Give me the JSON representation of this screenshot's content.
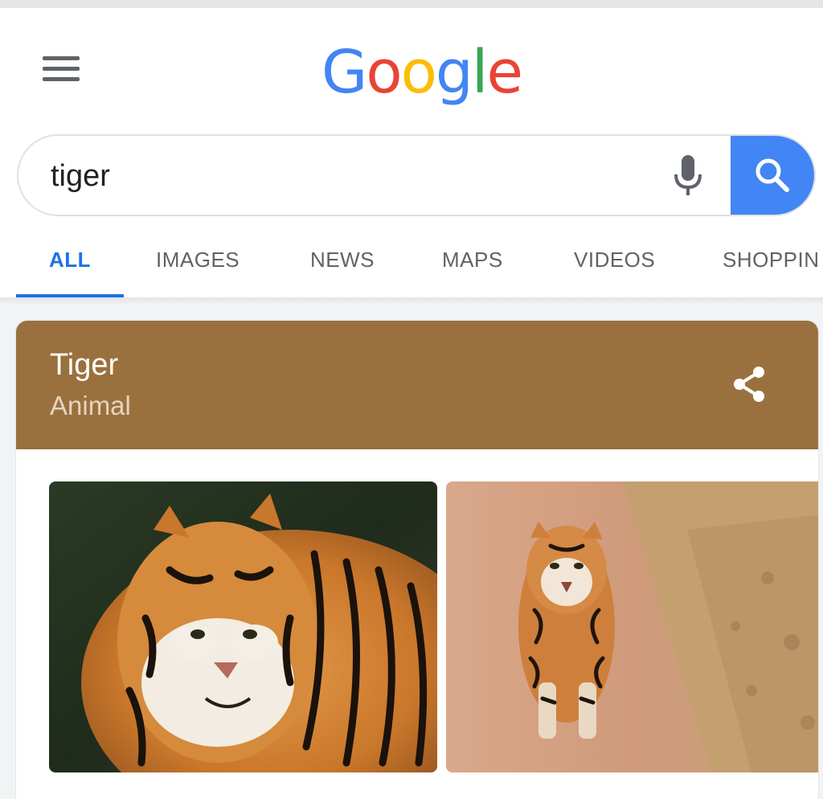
{
  "header": {
    "menu_icon": "hamburger-menu-icon",
    "logo_letters": [
      {
        "char": "G",
        "color": "#4285f4"
      },
      {
        "char": "o",
        "color": "#ea4335"
      },
      {
        "char": "o",
        "color": "#fbbc05"
      },
      {
        "char": "g",
        "color": "#4285f4"
      },
      {
        "char": "l",
        "color": "#34a853"
      },
      {
        "char": "e",
        "color": "#ea4335"
      }
    ]
  },
  "search": {
    "value": "tiger",
    "mic_icon": "microphone-icon",
    "search_icon": "search-icon",
    "button_color": "#4285f4"
  },
  "tabs": [
    {
      "label": "ALL",
      "active": true
    },
    {
      "label": "IMAGES",
      "active": false
    },
    {
      "label": "NEWS",
      "active": false
    },
    {
      "label": "MAPS",
      "active": false
    },
    {
      "label": "VIDEOS",
      "active": false
    },
    {
      "label": "SHOPPIN",
      "active": false
    }
  ],
  "knowledge_panel": {
    "title": "Tiger",
    "subtitle": "Animal",
    "header_color": "#9a713e",
    "share_icon": "share-icon",
    "images": [
      {
        "subject": "tiger close-up portrait"
      },
      {
        "subject": "tiger walking on dirt road"
      }
    ]
  }
}
